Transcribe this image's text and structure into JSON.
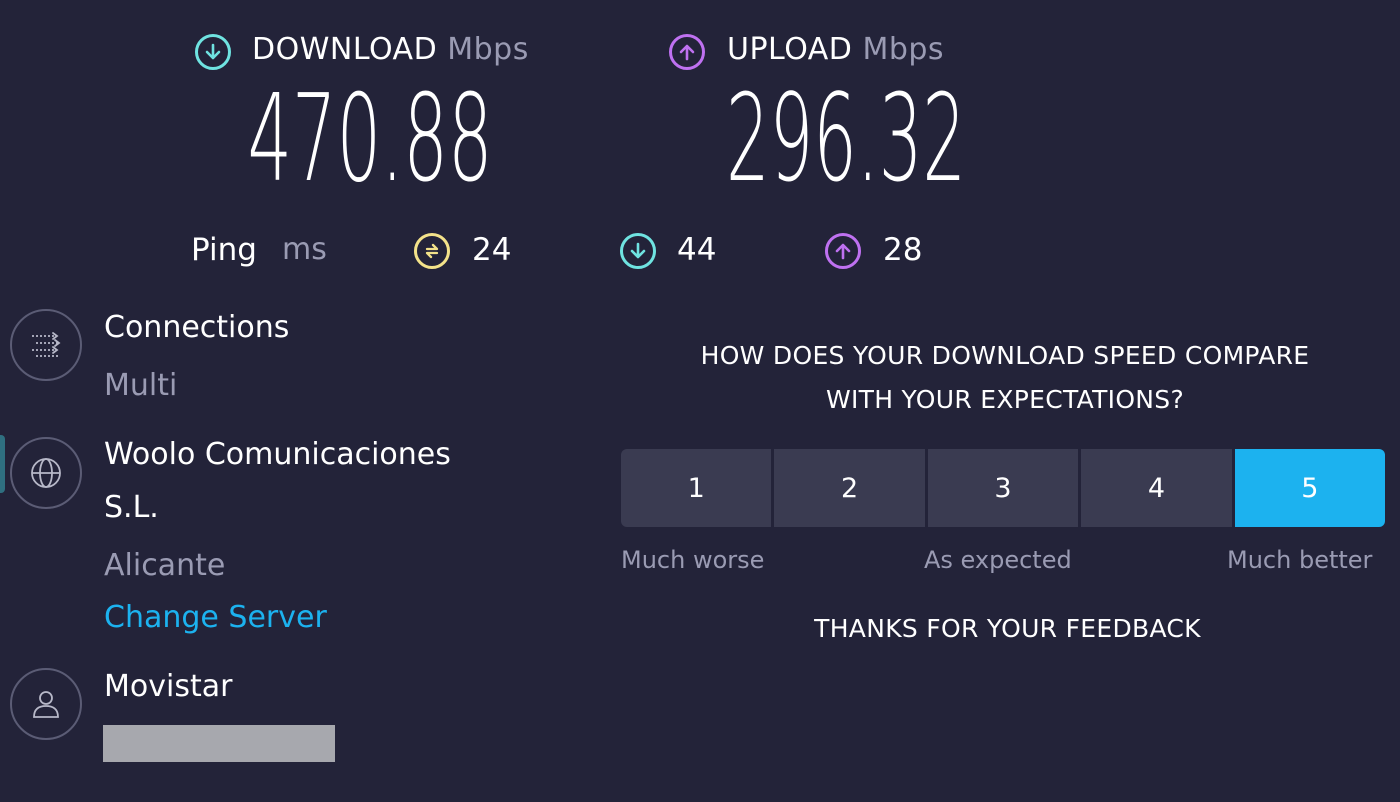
{
  "results": {
    "download": {
      "label": "DOWNLOAD",
      "unit": "Mbps",
      "value": "470.88",
      "icon": "download-arrow-icon",
      "color": "#6fe3e1"
    },
    "upload": {
      "label": "UPLOAD",
      "unit": "Mbps",
      "value": "296.32",
      "icon": "upload-arrow-icon",
      "color": "#bf71f1"
    }
  },
  "ping": {
    "label": "Ping",
    "unit": "ms",
    "idle": {
      "value": "24",
      "icon": "idle-ping-icon",
      "color": "#f3e28a"
    },
    "download": {
      "value": "44",
      "icon": "download-ping-icon",
      "color": "#6fe3e1"
    },
    "upload": {
      "value": "28",
      "icon": "upload-ping-icon",
      "color": "#bf71f1"
    }
  },
  "connections": {
    "title": "Connections",
    "value": "Multi",
    "icon": "connections-icon"
  },
  "server": {
    "name_line1": "Woolo Comunicaciones",
    "name_line2": "S.L.",
    "location": "Alicante",
    "change_link": "Change Server",
    "icon": "globe-icon"
  },
  "provider": {
    "name": "Movistar",
    "icon": "user-icon"
  },
  "feedback": {
    "question_line1": "HOW DOES YOUR DOWNLOAD SPEED COMPARE",
    "question_line2": "WITH YOUR EXPECTATIONS?",
    "options": [
      "1",
      "2",
      "3",
      "4",
      "5"
    ],
    "selected": "5",
    "scale_low": "Much worse",
    "scale_mid": "As expected",
    "scale_high": "Much better",
    "thanks": "THANKS FOR YOUR FEEDBACK",
    "accent": "#1cb2ef"
  }
}
